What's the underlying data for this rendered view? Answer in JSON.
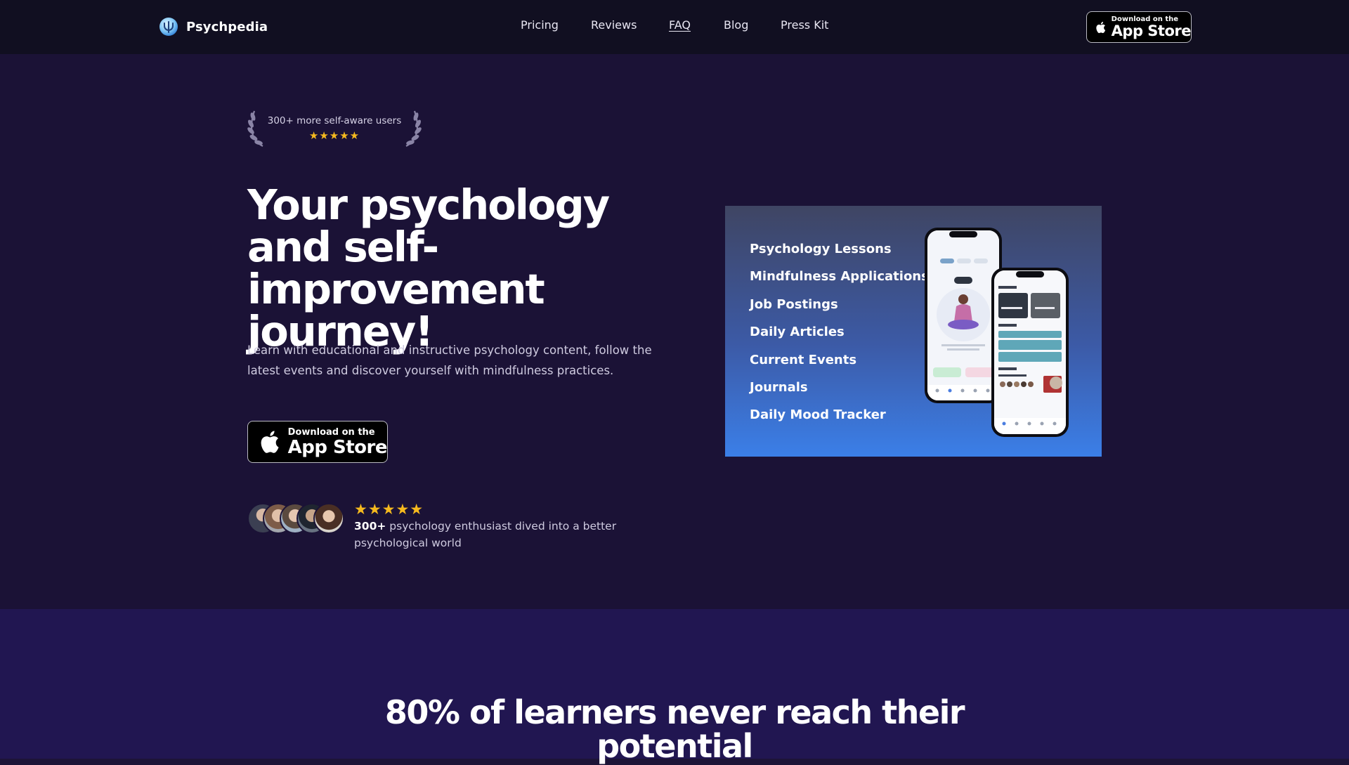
{
  "header": {
    "brand_name": "Psychpedia",
    "nav": [
      "Pricing",
      "Reviews",
      "FAQ",
      "Blog",
      "Press Kit"
    ],
    "appstore": {
      "small": "Download on the",
      "big": "App Store"
    }
  },
  "hero": {
    "badge_text": "300+ more self-aware users",
    "badge_stars": "★★★★★",
    "headline": "Your psychology and self-improvement journey!",
    "subtext": "Learn with educational and instructive psychology content, follow the latest events and discover yourself with mindfulness practices.",
    "appstore": {
      "small": "Download on the",
      "big": "App Store"
    },
    "proof_stars": "★★★★★",
    "proof_count": "300+",
    "proof_text": "psychology enthusiast dived into a better psychological world"
  },
  "features": [
    "Psychology Lessons",
    "Mindfulness Applications",
    "Job Postings",
    "Daily Articles",
    "Current Events",
    "Journals",
    "Daily Mood Tracker"
  ],
  "section2": {
    "title": "80% of learners never reach their potential"
  },
  "colors": {
    "page_bg": "#1b1236",
    "header_bg": "#110f21",
    "section2_bg": "#211651",
    "star": "#f5b91e",
    "card_gradient_end": "#3b7fe8"
  },
  "icons": [
    "psychpedia-logo-icon",
    "apple-icon",
    "laurel-left-icon",
    "laurel-right-icon",
    "star-icon"
  ]
}
